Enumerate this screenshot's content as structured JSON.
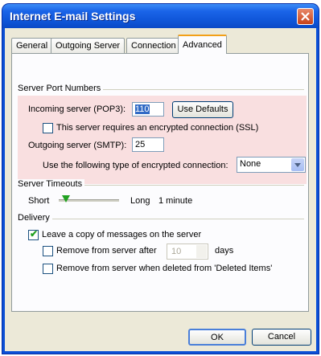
{
  "window": {
    "title": "Internet E-mail Settings"
  },
  "tabs": [
    "General",
    "Outgoing Server",
    "Connection",
    "Advanced"
  ],
  "active_tab": "Advanced",
  "server_ports": {
    "heading": "Server Port Numbers",
    "incoming_label": "Incoming server (POP3):",
    "incoming_value": "110",
    "use_defaults": "Use Defaults",
    "ssl_label": "This server requires an encrypted connection (SSL)",
    "ssl_checked": false,
    "outgoing_label": "Outgoing server (SMTP):",
    "outgoing_value": "25",
    "encryption_label": "Use the following type of encrypted connection:",
    "encryption_value": "None"
  },
  "timeouts": {
    "heading": "Server Timeouts",
    "short": "Short",
    "long": "Long",
    "value": "1 minute",
    "level": 0.05
  },
  "delivery": {
    "heading": "Delivery",
    "leave_copy": "Leave a copy of messages on the server",
    "leave_copy_checked": true,
    "remove_after": "Remove from server after",
    "remove_after_checked": false,
    "days_value": "10",
    "days_label": "days",
    "remove_deleted": "Remove from server when deleted from 'Deleted Items'",
    "remove_deleted_checked": false
  },
  "footer": {
    "ok": "OK",
    "cancel": "Cancel"
  }
}
